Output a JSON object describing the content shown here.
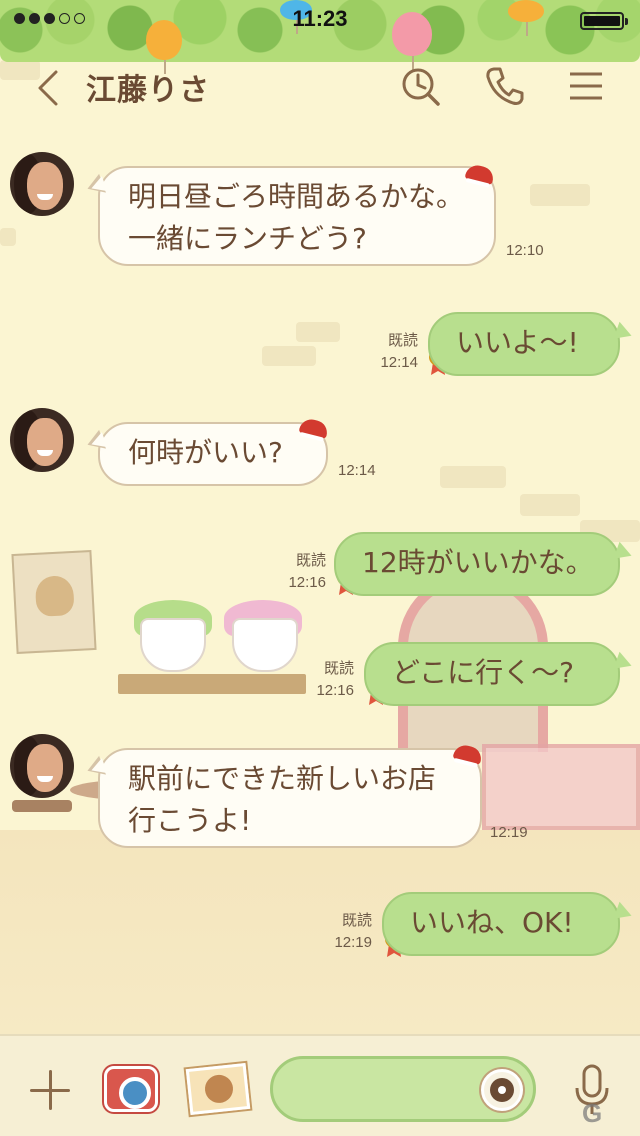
{
  "status_bar": {
    "time": "11:23",
    "signal_dots_filled": 3,
    "signal_dots_total": 5
  },
  "header": {
    "contact_name": "江藤りさ",
    "icons": [
      "back-icon",
      "search-clock-icon",
      "phone-icon",
      "menu-icon"
    ]
  },
  "messages": [
    {
      "direction": "in",
      "lines": [
        "明日昼ごろ時間あるかな。",
        "一緒にランチどう?"
      ],
      "time": "12:10"
    },
    {
      "direction": "out",
      "text": "いいよ～!",
      "read_label": "既読",
      "time": "12:14"
    },
    {
      "direction": "in",
      "lines": [
        "何時がいい?"
      ],
      "time": "12:14"
    },
    {
      "direction": "out",
      "text": "12時がいいかな。",
      "read_label": "既読",
      "time": "12:16"
    },
    {
      "direction": "out",
      "text": "どこに行く～?",
      "read_label": "既読",
      "time": "12:16"
    },
    {
      "direction": "in",
      "lines": [
        "駅前にできた新しいお店",
        "行こうよ!"
      ],
      "time": "12:19"
    },
    {
      "direction": "out",
      "text": "いいね、OK!",
      "read_label": "既読",
      "time": "12:19"
    }
  ],
  "bottom_bar": {
    "icons": [
      "plus-icon",
      "camera-icon",
      "photo-sticker-icon",
      "pokeball-icon",
      "mic-icon"
    ],
    "input_value": ""
  },
  "watermark": "G",
  "colors": {
    "background": "#fbf5d2",
    "incoming_bubble": "#fffdf5",
    "outgoing_bubble": "#b8df8e",
    "text": "#6a4a33"
  }
}
